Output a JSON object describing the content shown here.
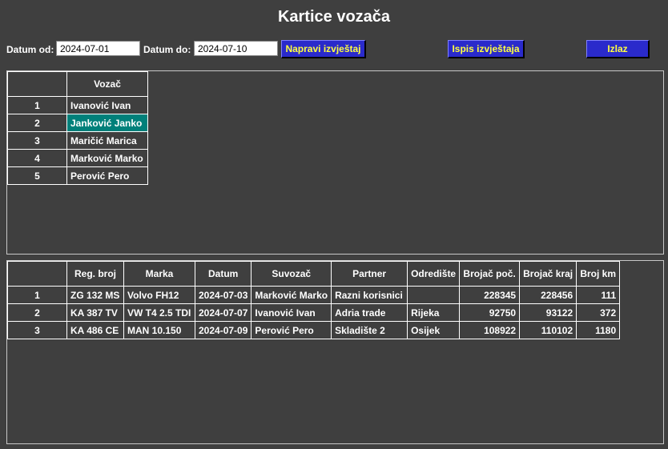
{
  "window": {
    "title": "Kartice vozača"
  },
  "filters": {
    "date_from_label": "Datum od:",
    "date_from_value": "2024-07-01",
    "date_to_label": "Datum do:",
    "date_to_value": "2024-07-10"
  },
  "buttons": {
    "make_report": "Napravi izvještaj",
    "print_report": "Ispis izvještaja",
    "exit": "Izlaz"
  },
  "drivers": {
    "header": [
      "",
      "Vozač"
    ],
    "rows": [
      {
        "no": "1",
        "name": "Ivanović Ivan"
      },
      {
        "no": "2",
        "name": "Janković Janko"
      },
      {
        "no": "3",
        "name": "Maričić Marica"
      },
      {
        "no": "4",
        "name": "Marković Marko"
      },
      {
        "no": "5",
        "name": "Perović Pero"
      }
    ],
    "selected_index": 1
  },
  "trips": {
    "header": [
      "",
      "Reg. broj",
      "Marka",
      "Datum",
      "Suvozač",
      "Partner",
      "Odredište",
      "Brojač poč.",
      "Brojač kraj",
      "Broj km"
    ],
    "rows": [
      [
        "1",
        "ZG 132 MS",
        "Volvo FH12",
        "2024-07-03",
        "Marković Marko",
        "Razni korisnici",
        "",
        "228345",
        "228456",
        "111"
      ],
      [
        "2",
        "KA 387 TV",
        "VW T4 2.5 TDI",
        "2024-07-07",
        "Ivanović Ivan",
        "Adria trade",
        "Rijeka",
        "92750",
        "93122",
        "372"
      ],
      [
        "3",
        "KA 486 CE",
        "MAN 10.150",
        "2024-07-09",
        "Perović Pero",
        "Skladište 2",
        "Osijek",
        "108922",
        "110102",
        "1180"
      ]
    ]
  },
  "colors": {
    "background": "#3f3f3f",
    "button_bg": "#2a2acb",
    "button_text": "#ffff40",
    "selected_row": "#00807a"
  }
}
